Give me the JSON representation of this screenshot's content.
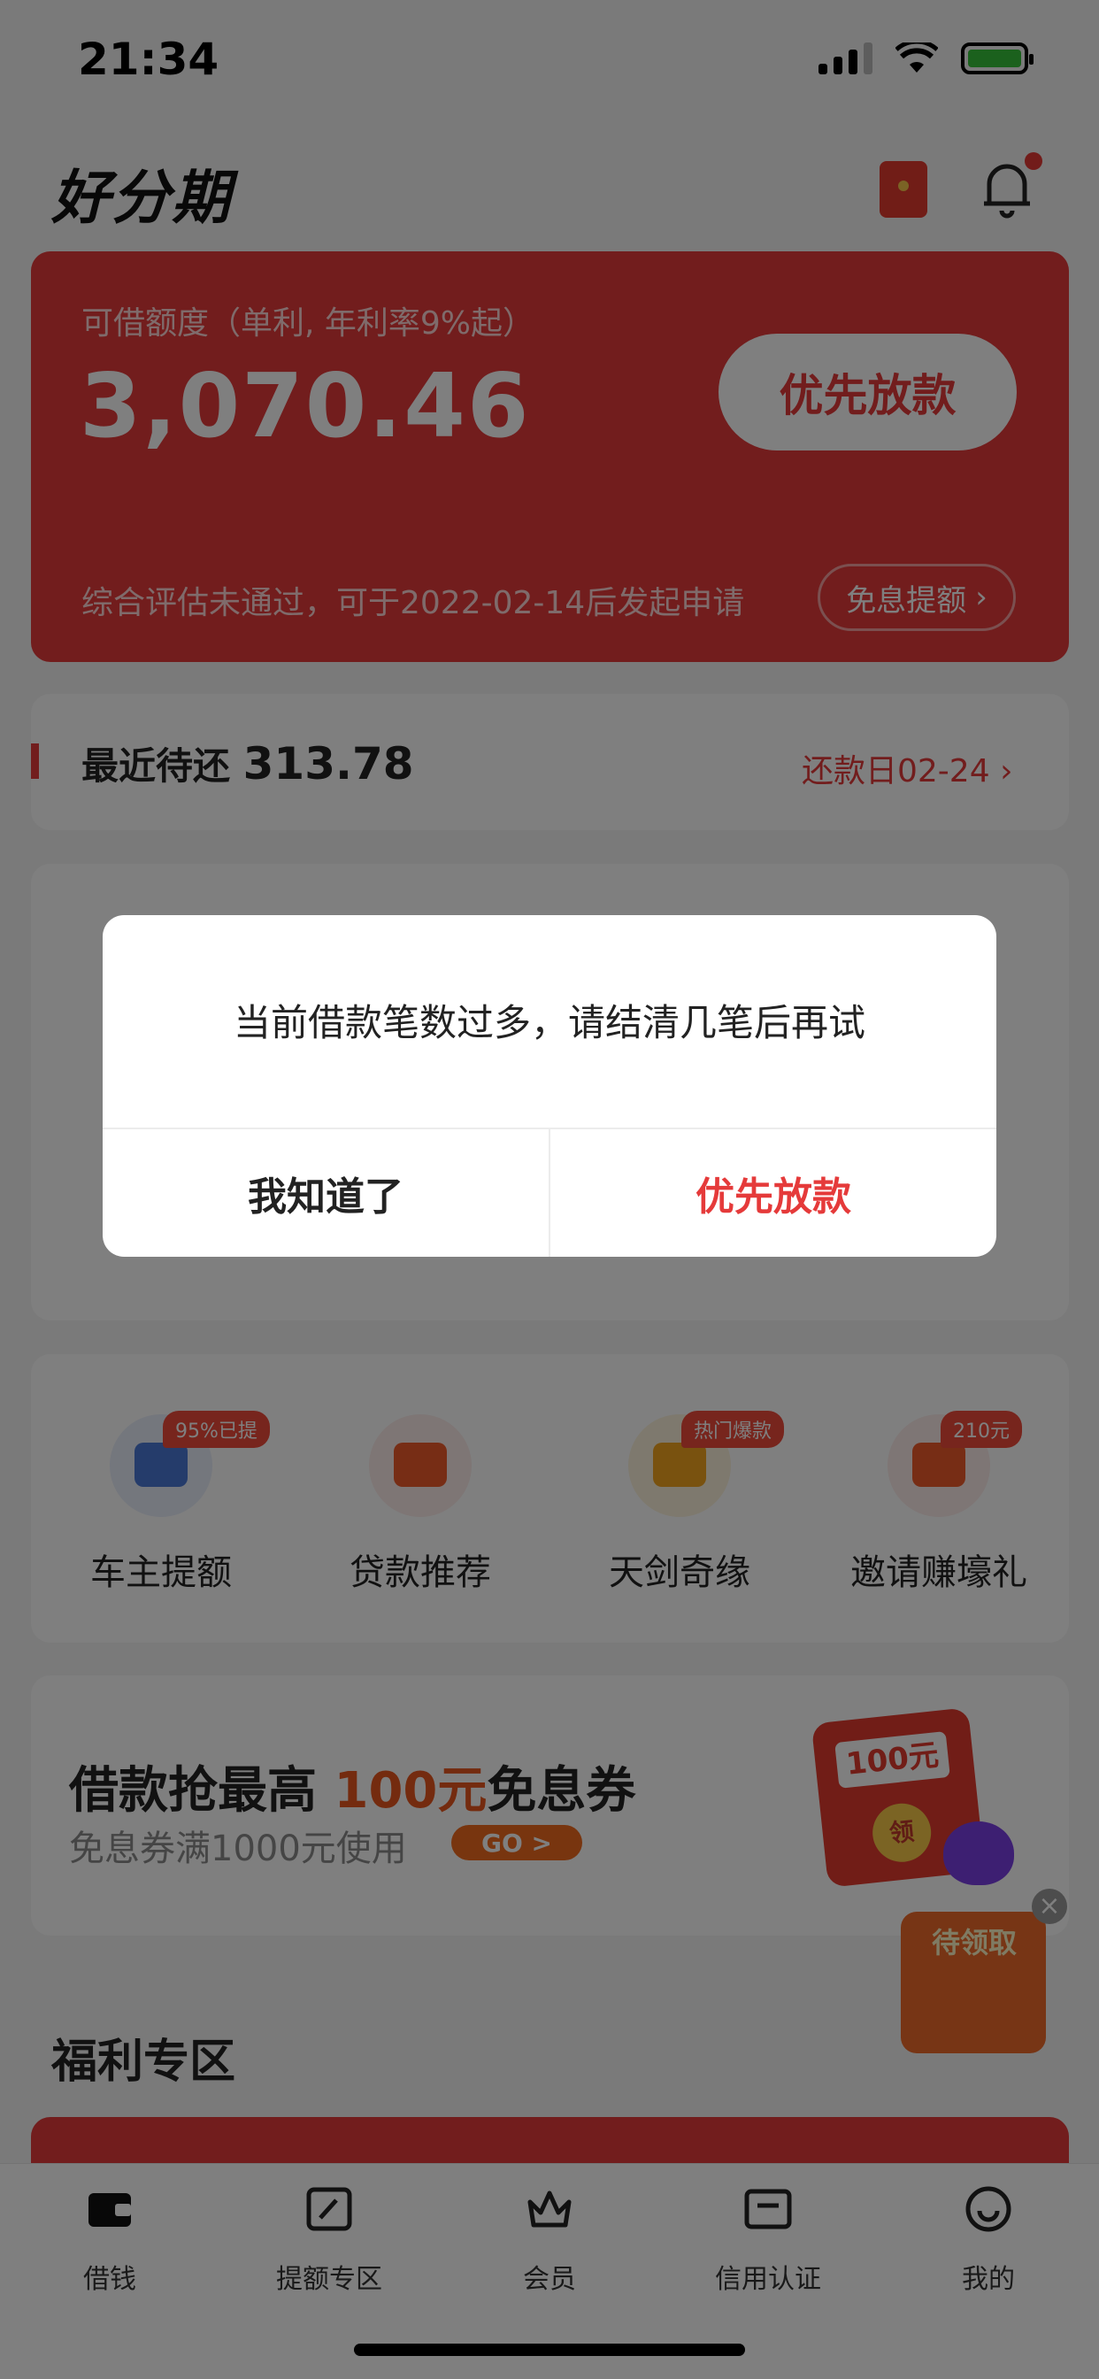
{
  "status_bar": {
    "time": "21:34"
  },
  "header": {
    "logo": "好分期"
  },
  "credit": {
    "label": "可借额度（单利, 年利率9%起）",
    "amount": "3,070.46",
    "primary_button": "优先放款",
    "note": "综合评估未通过，可于2022-02-14后发起申请",
    "secondary_button": "免息提额"
  },
  "repayment": {
    "label": "最近待还",
    "amount": "313.78",
    "date": "还款日02-24"
  },
  "services": [
    {
      "label": "车主提额",
      "badge": "95%已提",
      "icon": "car-icon",
      "color": "#4a78d6",
      "bg": "#e8eefb"
    },
    {
      "label": "贷款推荐",
      "badge": "",
      "icon": "wallet-icon",
      "color": "#ef5a2a",
      "bg": "#fdecea"
    },
    {
      "label": "天剑奇缘",
      "badge": "热门爆款",
      "icon": "gold-ingot-icon",
      "color": "#f2a51e",
      "bg": "#fdf3dc"
    },
    {
      "label": "邀请赚壕礼",
      "badge": "210元",
      "icon": "red-envelope-icon",
      "color": "#ef5a2a",
      "bg": "#fdecea"
    }
  ],
  "banner": {
    "title_prefix": "借款抢最高 ",
    "title_highlight": "100元",
    "title_suffix": "免息券",
    "subtitle": "免息券满1000元使用",
    "go_button": "GO >",
    "coupon_amount": "100元",
    "coupon_coin": "领"
  },
  "floating": {
    "close": "×",
    "label": "待领取"
  },
  "welfare": {
    "title": "福利专区"
  },
  "tabs": [
    {
      "label": "借钱",
      "icon": "wallet-tab-icon"
    },
    {
      "label": "提额专区",
      "icon": "edit-tab-icon"
    },
    {
      "label": "会员",
      "icon": "crown-tab-icon"
    },
    {
      "label": "信用认证",
      "icon": "card-tab-icon"
    },
    {
      "label": "我的",
      "icon": "smile-tab-icon"
    }
  ],
  "dialog": {
    "message": "当前借款笔数过多，请结清几笔后再试",
    "cancel_button": "我知道了",
    "confirm_button": "优先放款"
  }
}
